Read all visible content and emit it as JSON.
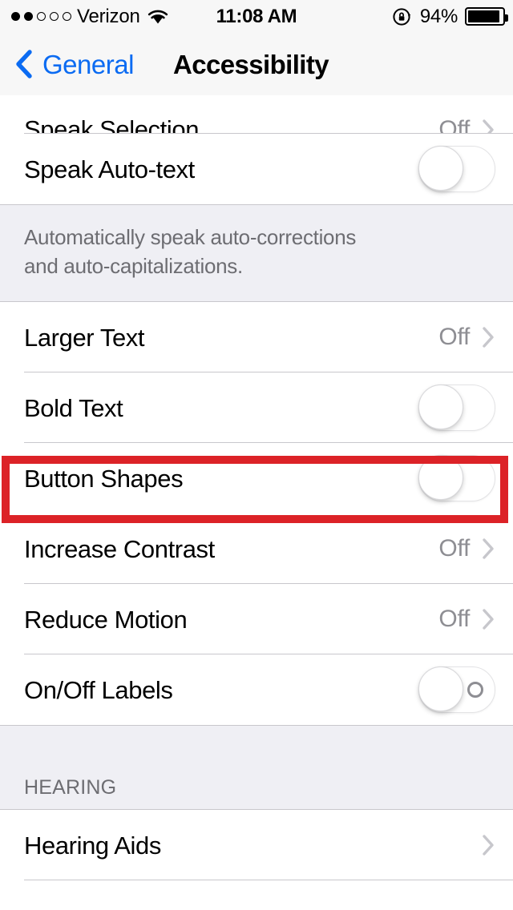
{
  "status_bar": {
    "signal_dots": {
      "filled": 2,
      "total": 5
    },
    "carrier": "Verizon",
    "wifi_icon": "wifi-icon",
    "time": "11:08 AM",
    "rotation_lock_icon": "rotation-lock-icon",
    "battery_percent": "94%",
    "battery_level": 94
  },
  "nav_bar": {
    "back_icon": "chevron-left-icon",
    "back_label": "General",
    "title": "Accessibility"
  },
  "list": {
    "rows_top": [
      {
        "label": "Speak Selection",
        "value": "Off",
        "accessory": "chevron",
        "clipped": true
      },
      {
        "label": "Speak Auto-text",
        "value": "",
        "accessory": "toggle",
        "toggle_on": false
      }
    ],
    "footer_note_line1": "Automatically speak auto-corrections",
    "footer_note_line2": "and auto-capitalizations.",
    "rows_vision": [
      {
        "label": "Larger Text",
        "value": "Off",
        "accessory": "chevron"
      },
      {
        "label": "Bold Text",
        "value": "",
        "accessory": "toggle",
        "toggle_on": false
      },
      {
        "label": "Button Shapes",
        "value": "",
        "accessory": "toggle",
        "toggle_on": false,
        "highlighted": true
      },
      {
        "label": "Increase Contrast",
        "value": "Off",
        "accessory": "chevron"
      },
      {
        "label": "Reduce Motion",
        "value": "Off",
        "accessory": "chevron"
      },
      {
        "label": "On/Off Labels",
        "value": "",
        "accessory": "toggle-labeled",
        "toggle_on": false
      }
    ],
    "hearing_header": "HEARING",
    "rows_hearing": [
      {
        "label": "Hearing Aids",
        "value": "",
        "accessory": "chevron"
      }
    ]
  },
  "annotation": {
    "type": "highlight-rectangle",
    "target": "Button Shapes",
    "color": "#dc2227"
  },
  "colors": {
    "accent_blue": "#0b6bf2",
    "group_background": "#efeff4",
    "separator": "#c8c7cc",
    "secondary_text": "#6d6d72",
    "value_text": "#8e8e93",
    "chevron": "#c7c7cc",
    "highlight_red": "#dc2227"
  }
}
